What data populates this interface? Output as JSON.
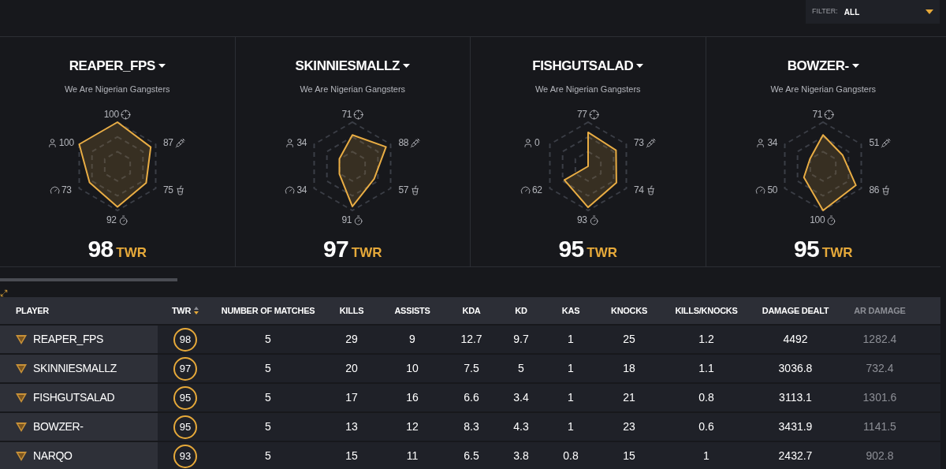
{
  "filter": {
    "label": "FILTER:",
    "value": "ALL"
  },
  "players": [
    {
      "name": "REAPER_FPS",
      "team": "We Are Nigerian Gangsters",
      "stats": [
        "100",
        "87",
        "75",
        "92",
        "73",
        "100"
      ],
      "twr": "98",
      "twr_unit": "TWR"
    },
    {
      "name": "SKINNIESMALLZ",
      "team": "We Are Nigerian Gangsters",
      "stats": [
        "71",
        "88",
        "57",
        "91",
        "34",
        "34"
      ],
      "twr": "97",
      "twr_unit": "TWR"
    },
    {
      "name": "FISHGUTSALAD",
      "team": "We Are Nigerian Gangsters",
      "stats": [
        "77",
        "73",
        "74",
        "93",
        "62",
        "0"
      ],
      "twr": "95",
      "twr_unit": "TWR"
    },
    {
      "name": "BOWZER-",
      "team": "We Are Nigerian Gangsters",
      "stats": [
        "71",
        "51",
        "86",
        "100",
        "50",
        "34"
      ],
      "twr": "95",
      "twr_unit": "TWR"
    }
  ],
  "table": {
    "columns": [
      {
        "label": "PLAYER",
        "faded": false
      },
      {
        "label": "TWR",
        "faded": false
      },
      {
        "label": "NUMBER OF MATCHES",
        "faded": false
      },
      {
        "label": "KILLS",
        "faded": false
      },
      {
        "label": "ASSISTS",
        "faded": false
      },
      {
        "label": "KDA",
        "faded": false
      },
      {
        "label": "KD",
        "faded": false
      },
      {
        "label": "KAS",
        "faded": false
      },
      {
        "label": "KNOCKS",
        "faded": false
      },
      {
        "label": "KILLS/KNOCKS",
        "faded": false
      },
      {
        "label": "DAMAGE DEALT",
        "faded": false
      },
      {
        "label": "AR DAMAGE",
        "faded": true
      }
    ],
    "rows": [
      [
        "REAPER_FPS",
        "98",
        "5",
        "29",
        "9",
        "12.7",
        "9.7",
        "1",
        "25",
        "1.2",
        "4492",
        "1282.4"
      ],
      [
        "SKINNIESMALLZ",
        "97",
        "5",
        "20",
        "10",
        "7.5",
        "5",
        "1",
        "18",
        "1.1",
        "3036.8",
        "732.4"
      ],
      [
        "FISHGUTSALAD",
        "95",
        "5",
        "17",
        "16",
        "6.6",
        "3.4",
        "1",
        "21",
        "0.8",
        "3113.1",
        "1301.6"
      ],
      [
        "BOWZER-",
        "95",
        "5",
        "13",
        "12",
        "8.3",
        "4.3",
        "1",
        "23",
        "0.6",
        "3431.9",
        "1141.5"
      ],
      [
        "NARQO",
        "93",
        "5",
        "15",
        "11",
        "6.5",
        "3.8",
        "0.8",
        "15",
        "1",
        "2432.7",
        "902.8"
      ]
    ]
  }
}
